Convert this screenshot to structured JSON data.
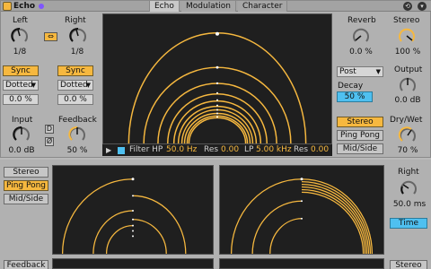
{
  "header": {
    "title": "Echo",
    "tabs": [
      "Echo",
      "Modulation",
      "Character"
    ]
  },
  "left": {
    "left_label": "Left",
    "left_value": "1/8",
    "right_label": "Right",
    "right_value": "1/8",
    "sync_left": "Sync",
    "sync_right": "Sync",
    "mode_left": "Dotted",
    "mode_right": "Dotted",
    "offset_left": "0.0 %",
    "offset_right": "0.0 %",
    "input_label": "Input",
    "input_value": "0.0 dB",
    "d_label": "D",
    "phase_label": "Ø",
    "feedback_label": "Feedback",
    "feedback_value": "50 %"
  },
  "filter": {
    "filter_hp_label": "Filter HP",
    "hp_value": "50.0 Hz",
    "res_label_1": "Res",
    "res_value_1": "0.00",
    "lp_label": "LP",
    "lp_value": "5.00 kHz",
    "res_label_2": "Res",
    "res_value_2": "0.00"
  },
  "right": {
    "reverb_label": "Reverb",
    "reverb_value": "0.0 %",
    "stereo_label": "Stereo",
    "stereo_value": "100 %",
    "post_value": "Post",
    "decay_label": "Decay",
    "decay_value": "50 %",
    "output_label": "Output",
    "output_value": "0.0 dB",
    "stereo_btn": "Stereo",
    "pingpong_btn": "Ping Pong",
    "midside_btn": "Mid/Side",
    "drywet_label": "Dry/Wet",
    "drywet_value": "70 %"
  },
  "lower": {
    "stereo_btn": "Stereo",
    "pingpong_btn": "Ping Pong",
    "midside_btn": "Mid/Side",
    "right_label": "Right",
    "right_value": "50.0 ms",
    "time_btn": "Time",
    "feedback_label": "Feedback",
    "stereo_label_2": "Stereo"
  },
  "colors": {
    "accent": "#f6b83f",
    "blue": "#4fc0f0",
    "display_bg": "#1f1f1f"
  }
}
